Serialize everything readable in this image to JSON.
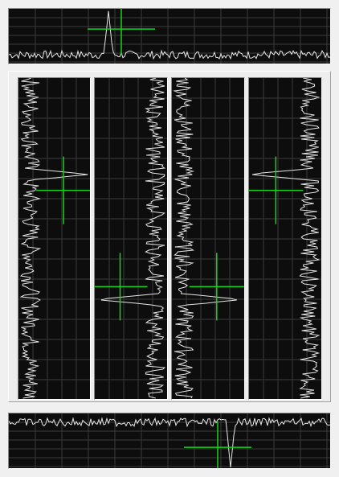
{
  "colors": {
    "background": "#f0f0f0",
    "plot_background": "#0d0d0d",
    "grid": "#3a3a3a",
    "trace": "#e6e6e6",
    "crosshair": "#19d219"
  },
  "panels": [
    {
      "name": "top-spectrum-panel",
      "orientation": "horizontal",
      "baseline": "bottom",
      "peak_direction": "up",
      "peak_position": 0.31,
      "crosshair": {
        "x": 0.35,
        "y": 0.37
      }
    },
    {
      "name": "bottom-spectrum-panel",
      "orientation": "horizontal",
      "baseline": "top",
      "peak_direction": "down",
      "peak_position": 0.69,
      "crosshair": {
        "x": 0.65,
        "y": 0.62
      }
    },
    {
      "name": "vertical-trace-panel-1",
      "orientation": "vertical",
      "baseline": "left",
      "peak_direction": "right",
      "peak_position": 0.3,
      "crosshair": {
        "x": 0.63,
        "y": 0.35
      }
    },
    {
      "name": "vertical-trace-panel-2",
      "orientation": "vertical",
      "baseline": "right",
      "peak_direction": "left",
      "peak_position": 0.69,
      "crosshair": {
        "x": 0.35,
        "y": 0.65
      }
    },
    {
      "name": "vertical-trace-panel-3",
      "orientation": "vertical",
      "baseline": "left",
      "peak_direction": "right",
      "peak_position": 0.69,
      "crosshair": {
        "x": 0.62,
        "y": 0.65
      }
    },
    {
      "name": "vertical-trace-panel-4",
      "orientation": "vertical",
      "baseline": "right",
      "peak_direction": "left",
      "peak_position": 0.3,
      "crosshair": {
        "x": 0.37,
        "y": 0.35
      }
    }
  ]
}
